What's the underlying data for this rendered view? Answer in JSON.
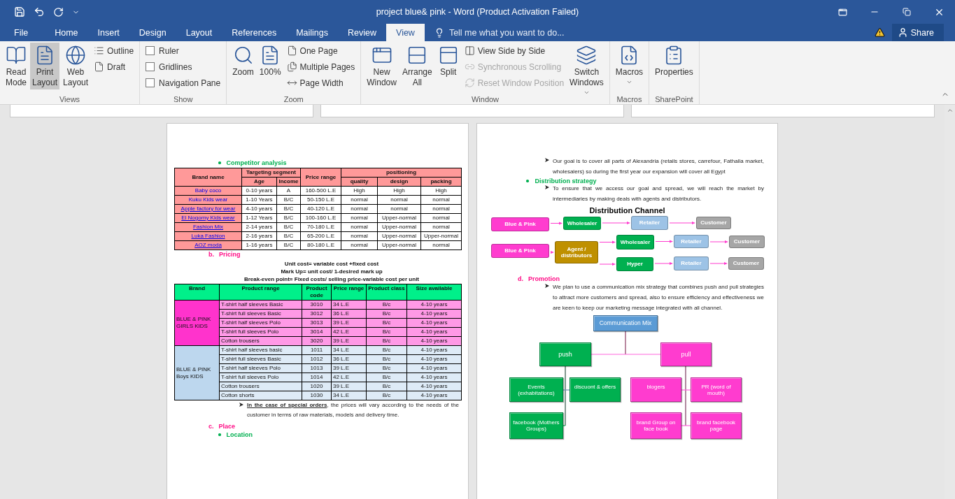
{
  "window": {
    "title": "project blue& pink - Word (Product Activation Failed)"
  },
  "tabs": [
    {
      "label": "File",
      "selected": false
    },
    {
      "label": "Home",
      "selected": false
    },
    {
      "label": "Insert",
      "selected": false
    },
    {
      "label": "Design",
      "selected": false
    },
    {
      "label": "Layout",
      "selected": false
    },
    {
      "label": "References",
      "selected": false
    },
    {
      "label": "Mailings",
      "selected": false
    },
    {
      "label": "Review",
      "selected": false
    },
    {
      "label": "View",
      "selected": true
    }
  ],
  "tell_me": {
    "placeholder": "Tell me what you want to do..."
  },
  "share": {
    "label": "Share"
  },
  "ribbon": [
    {
      "name": "Views",
      "items": [
        {
          "kind": "large",
          "label": "Read Mode",
          "selected": false
        },
        {
          "kind": "large",
          "label": "Print Layout",
          "selected": true
        },
        {
          "kind": "large",
          "label": "Web Layout",
          "selected": false
        },
        {
          "kind": "small",
          "label": "Outline",
          "selected": false
        },
        {
          "kind": "small",
          "label": "Draft",
          "selected": false
        }
      ]
    },
    {
      "name": "Show",
      "items": [
        {
          "kind": "check",
          "label": "Ruler",
          "checked": false
        },
        {
          "kind": "check",
          "label": "Gridlines",
          "checked": false
        },
        {
          "kind": "check",
          "label": "Navigation Pane",
          "checked": false
        }
      ]
    },
    {
      "name": "Zoom",
      "items": [
        {
          "kind": "large",
          "label": "Zoom"
        },
        {
          "kind": "large",
          "label": "100%"
        },
        {
          "kind": "small",
          "label": "One Page"
        },
        {
          "kind": "small",
          "label": "Multiple Pages"
        },
        {
          "kind": "small",
          "label": "Page Width"
        }
      ]
    },
    {
      "name": "Window",
      "items": [
        {
          "kind": "large",
          "label": "New Window"
        },
        {
          "kind": "large",
          "label": "Arrange All"
        },
        {
          "kind": "large",
          "label": "Split"
        },
        {
          "kind": "small",
          "label": "View Side by Side",
          "disabled": false
        },
        {
          "kind": "small",
          "label": "Synchronous Scrolling",
          "disabled": true
        },
        {
          "kind": "small",
          "label": "Reset Window Position",
          "disabled": true
        },
        {
          "kind": "large",
          "label": "Switch Windows",
          "dropdown": true
        }
      ]
    },
    {
      "name": "Macros",
      "items": [
        {
          "kind": "large",
          "label": "Macros",
          "dropdown": true
        }
      ]
    },
    {
      "name": "SharePoint",
      "items": [
        {
          "kind": "large",
          "label": "Properties"
        }
      ]
    }
  ],
  "left_page": {
    "competitor": {
      "heading": "Competitor analysis",
      "head": {
        "brand": "Brand name",
        "segment": "Targeting segment",
        "price": "Price range",
        "positioning": "positioning",
        "age": "Age",
        "income": "Income",
        "quality": "quality",
        "design": "design",
        "packing": "packing"
      },
      "rows": [
        {
          "underlined": false,
          "cells": [
            "Baby coco",
            "0-10 years",
            "A",
            "160-500 L.E",
            "High",
            "High",
            "High"
          ]
        },
        {
          "underlined": false,
          "cells": [
            "Kuku Kids wear",
            "1-10 Years",
            "B/C",
            "50-150 L.E",
            "normal",
            "normal",
            "normal"
          ]
        },
        {
          "underlined": true,
          "cells": [
            "Apple factory for wear",
            "4-10 years",
            "B/C",
            "40-120 L.E",
            "normal",
            "normal",
            "normal"
          ]
        },
        {
          "underlined": true,
          "cells": [
            "El Nogomy Kids wear",
            "1-12 Years",
            "B/C",
            "100-160 L.E",
            "normal",
            "Upper-normal",
            "normal"
          ]
        },
        {
          "underlined": true,
          "cells": [
            "Fashion Mix",
            "2-14 years",
            "B/C",
            "70-180 L.E",
            "normal",
            "Upper-normal",
            "normal"
          ]
        },
        {
          "underlined": true,
          "cells": [
            "Luka Fashion",
            "2-16 years",
            "B/C",
            "65-200 L.E",
            "normal",
            "Upper-normal",
            "Upper-normal"
          ]
        },
        {
          "underlined": true,
          "cells": [
            "AOZ moda",
            "1-16 years",
            "B/C",
            "80-180 L.E",
            "normal",
            "Upper-normal",
            "normal"
          ]
        }
      ]
    },
    "pricing": {
      "marker": "b.",
      "heading": "Pricing",
      "formulas": [
        "Unit cost= variable cost +fixed cost",
        "Mark Up= unit cost/ 1-desired mark up",
        "Break-even point= Fixed costs/ selling price-variable cost per unit"
      ],
      "columns": [
        "Brand",
        "Product range",
        "Product code",
        "Price range",
        "Product class",
        "Size available"
      ],
      "groups": [
        {
          "brand": "BLUE & PINK GIRLS KIDS",
          "color": "#ff33cc",
          "rows": [
            [
              "T-shirt half sleeves Basic",
              "3010",
              "34 L.E",
              "B/c",
              "4-10 years"
            ],
            [
              "T-shirt full sleeves Basic",
              "3012",
              "36 L.E",
              "B/c",
              "4-10 years"
            ],
            [
              "T-shirt half sleeves Polo",
              "3013",
              "39 L.E",
              "B/c",
              "4-10 years"
            ],
            [
              "T-shirt full sleeves Polo",
              "3014",
              "42 L.E",
              "B/c",
              "4-10 years"
            ],
            [
              "Cotton trousers",
              "3020",
              "39 L.E",
              "B/c",
              "4-10 years"
            ]
          ]
        },
        {
          "brand": "BLUE & PINK Boys KIDS",
          "color": "#bdd7ee",
          "rows": [
            [
              "T-shirt half sleeves basic",
              "1011",
              "34 L.E",
              "B/c",
              "4-10 years"
            ],
            [
              "T-shirt full sleeves Basic",
              "1012",
              "36 L.E",
              "B/c",
              "4-10 years"
            ],
            [
              "T-shirt half sleeves Polo",
              "1013",
              "39 L.E",
              "B/c",
              "4-10 years"
            ],
            [
              "T-shirt full sleeves Polo",
              "1014",
              "42 L.E",
              "B/c",
              "4-10 years"
            ],
            [
              "Cotton trousers",
              "1020",
              "39 L.E",
              "B/c",
              "4-10 years"
            ],
            [
              "Cotton shorts",
              "1030",
              "34 L.E",
              "B/c",
              "4-10 years"
            ]
          ]
        }
      ],
      "note": "**In the case of special orders**, the prices will vary according to the needs of the customer in terms of raw materials, models and delivery time."
    },
    "place": {
      "marker": "c.",
      "heading": "Place",
      "bullet": "Location"
    }
  },
  "right_page": {
    "place_text": "Our goal is to cover all parts of Alexandria (retails stores, carrefour, Fathalla market, wholesalers) so during the first year our expansion will cover all Egypt",
    "distribution": {
      "heading": "Distribution strategy",
      "text": "To ensure that we access our goal and spread, we will reach the market by intermediaries by making deals with agents and distributors.",
      "title": "Distribution Channel",
      "nodes": [
        {
          "label": "Blue & Pink",
          "color": "#ff3ccf"
        },
        {
          "label": "Wholesaler",
          "color": "#00b050"
        },
        {
          "label": "Retailer",
          "color": "#9dc3e6"
        },
        {
          "label": "Customer",
          "color": "#a6a6a6"
        },
        {
          "label": "Blue & Pink",
          "color": "#ff3ccf"
        },
        {
          "label": "Agent / distributors",
          "color": "#bf9000"
        },
        {
          "label": "Wholesaler",
          "color": "#00b050"
        },
        {
          "label": "Retailer",
          "color": "#9dc3e6"
        },
        {
          "label": "Customer",
          "color": "#a6a6a6"
        },
        {
          "label": "Hyper",
          "color": "#00b050"
        },
        {
          "label": "Retailer",
          "color": "#9dc3e6"
        },
        {
          "label": "Customer",
          "color": "#a6a6a6"
        }
      ]
    },
    "promotion": {
      "marker": "d.",
      "heading": "Promotion",
      "text": "We plan to use a communication mix strategy that combines push and pull strategies to attract more customers and spread, also to ensure efficiency and effectiveness we are keen to keep our marketing message integrated with all channel.",
      "mix": {
        "label": "Communication Mix",
        "color": "#5b9bd5",
        "children": [
          {
            "label": "push",
            "color": "#00b050",
            "children": [
              {
                "label": "Events (exhabitations)",
                "color": "#00b050"
              },
              {
                "label": "discuont & offers",
                "color": "#00b050"
              },
              {
                "label": "facebook (Mothers Groups)",
                "color": "#00b050"
              }
            ]
          },
          {
            "label": "pull",
            "color": "#ff3ccf",
            "children": [
              {
                "label": "blogers",
                "color": "#ff3ccf"
              },
              {
                "label": "PR (word of mouth)",
                "color": "#ff3ccf"
              },
              {
                "label": "brand Group on face book",
                "color": "#ff3ccf"
              },
              {
                "label": "brand facebook page",
                "color": "#ff3ccf"
              }
            ]
          }
        ]
      }
    }
  }
}
